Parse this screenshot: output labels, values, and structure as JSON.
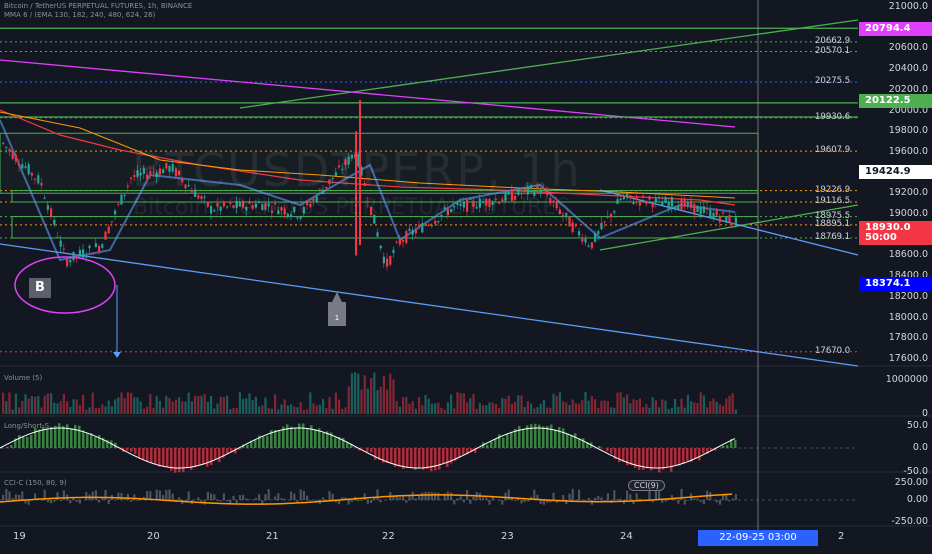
{
  "header": {
    "symbol_line": "Bitcoin / TetherUS PERPETUAL FUTURES, 1h, BINANCE",
    "indicator_line": "MMA 6 / (EMA 130, 182, 240, 480, 624, 26)"
  },
  "watermark": {
    "title": "BTCUSDTPERP, 1h",
    "subtitle": "Bitcoin / TetherUS PERPETUAL FUTURES"
  },
  "price_scale": {
    "ticks": [
      "21000.0",
      "20800.0",
      "20600.0",
      "20400.0",
      "20200.0",
      "20000.0",
      "19800.0",
      "19600.0",
      "19400.0",
      "19200.0",
      "19000.0",
      "18800.0",
      "18600.0",
      "18400.0",
      "18200.0",
      "18000.0",
      "17800.0",
      "17600.0"
    ]
  },
  "price_levels": [
    "20662.9",
    "20570.1",
    "20275.5",
    "19930.6",
    "19607.9",
    "19226.9",
    "19116.5",
    "18975.5",
    "18895.1",
    "18769.1",
    "17670.0"
  ],
  "price_tags": [
    {
      "text": "20794.4",
      "bg": "#e040fb",
      "fg": "#ffffff"
    },
    {
      "text": "20122.5",
      "bg": "#4caf50",
      "fg": "#ffffff"
    },
    {
      "text": "19424.9",
      "bg": "#ffffff",
      "fg": "#131722"
    },
    {
      "text": "18930.0",
      "bg": "#f23645",
      "fg": "#ffffff"
    },
    {
      "text": "50:00",
      "bg": "#f23645",
      "fg": "#ffffff"
    },
    {
      "text": "18374.1",
      "bg": "#0000ff",
      "fg": "#ffffff"
    }
  ],
  "markers": {
    "b_label": "B",
    "arrow_label": "1",
    "cci_tag": "CCI(9)"
  },
  "panes": {
    "volume": {
      "title": "Volume (5)",
      "scale": [
        "1000000",
        "0"
      ]
    },
    "longshort": {
      "title": "Long/Short-S",
      "scale": [
        "50.0",
        "0.0",
        "-50.0"
      ]
    },
    "cci": {
      "title": "CCI-C (150, 80, 9)",
      "scale": [
        "250.00",
        "0.00",
        "-250.00"
      ]
    }
  },
  "time_axis": {
    "days": [
      "19",
      "20",
      "21",
      "22",
      "23",
      "24",
      "2"
    ],
    "cursor_time": "22-09-25   03:00"
  },
  "colors": {
    "bg": "#131722",
    "up": "#26a69a",
    "down": "#f23645",
    "magenta": "#e040fb",
    "green": "#4caf50",
    "blue": "#5b9cf6",
    "orange": "#ff9800"
  }
}
